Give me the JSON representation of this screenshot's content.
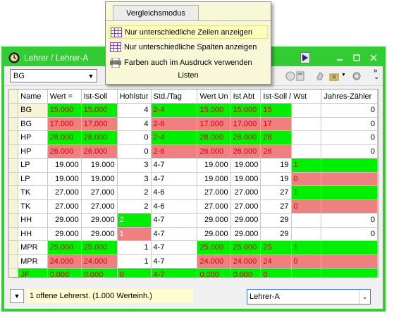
{
  "window": {
    "title": "Lehrer / Lehrer-A",
    "accent": "#33cc33"
  },
  "toolbar": {
    "combo_value": "BG"
  },
  "menu": {
    "tab": "Vergleichsmodus",
    "items": [
      "Nur unterschiedliche Zeilen anzeigen",
      "Nur unterschiedliche Spalten anzeigen",
      "Farben auch im Ausdruck verwenden"
    ],
    "footer": "Listen"
  },
  "grid": {
    "headers": [
      "Name",
      "Wert =",
      "Ist-Soll",
      "Hohlstur",
      "Std./Tag",
      "Wert Un",
      "Ist Abt",
      "Ist-Soll / Wst",
      "",
      "Jahres-Zähler"
    ],
    "rows": [
      {
        "name": "BG",
        "wert": "15.000",
        "ist": "15.000",
        "hohl": "4",
        "std": "2-4",
        "wun": "15.000",
        "abt": "15.000",
        "iw": "15",
        "wst": "",
        "jz": "0",
        "style": "sel-green"
      },
      {
        "name": "BG",
        "wert": "17.000",
        "ist": "17.000",
        "hohl": "4",
        "std": "2-6",
        "wun": "17.000",
        "abt": "17.000",
        "iw": "17",
        "wst": "",
        "jz": "0",
        "style": "red"
      },
      {
        "name": "HP",
        "wert": "28.000",
        "ist": "28.000",
        "hohl": "0",
        "std": "2-4",
        "wun": "28.000",
        "abt": "28.000",
        "iw": "28",
        "wst": "",
        "jz": "0",
        "style": "green"
      },
      {
        "name": "HP",
        "wert": "26.000",
        "ist": "26.000",
        "hohl": "0",
        "std": "2-6",
        "wun": "26.000",
        "abt": "26.000",
        "iw": "26",
        "wst": "",
        "jz": "0",
        "style": "red"
      },
      {
        "name": "LP",
        "wert": "19.000",
        "ist": "19.000",
        "hohl": "3",
        "std": "4-7",
        "wun": "19.000",
        "abt": "19.000",
        "iw": "19",
        "wst": "1",
        "jz": "",
        "style": "plain-g"
      },
      {
        "name": "LP",
        "wert": "19.000",
        "ist": "19.000",
        "hohl": "3",
        "std": "4-7",
        "wun": "19.000",
        "abt": "19.000",
        "iw": "19",
        "wst": "0",
        "jz": "",
        "style": "plain-r"
      },
      {
        "name": "TK",
        "wert": "27.000",
        "ist": "27.000",
        "hohl": "2",
        "std": "4-6",
        "wun": "27.000",
        "abt": "27.000",
        "iw": "27",
        "wst": "1",
        "jz": "",
        "style": "plain-g"
      },
      {
        "name": "TK",
        "wert": "27.000",
        "ist": "27.000",
        "hohl": "2",
        "std": "4-6",
        "wun": "27.000",
        "abt": "27.000",
        "iw": "27",
        "wst": "0",
        "jz": "",
        "style": "plain-r"
      },
      {
        "name": "HH",
        "wert": "29.000",
        "ist": "29.000",
        "hohl": "2",
        "std": "4-7",
        "wun": "29.000",
        "abt": "29.000",
        "iw": "29",
        "wst": "",
        "jz": "0",
        "style": "hohl-g"
      },
      {
        "name": "HH",
        "wert": "29.000",
        "ist": "29.000",
        "hohl": "1",
        "std": "4-7",
        "wun": "29.000",
        "abt": "29.000",
        "iw": "29",
        "wst": "",
        "jz": "0",
        "style": "hohl-r"
      },
      {
        "name": "MPR",
        "wert": "25.000",
        "ist": "25.000",
        "hohl": "1",
        "std": "4-7",
        "wun": "25.000",
        "abt": "25.000",
        "iw": "25",
        "wst": "1",
        "jz": "",
        "style": "mpr-g"
      },
      {
        "name": "MPR",
        "wert": "24.000",
        "ist": "24.000",
        "hohl": "1",
        "std": "4-7",
        "wun": "24.000",
        "abt": "24.000",
        "iw": "24",
        "wst": "0",
        "jz": "",
        "style": "mpr-r"
      },
      {
        "name": "JF",
        "wert": "0.000",
        "ist": "0.000",
        "hohl": "0",
        "std": "4-7",
        "wun": "0.000",
        "abt": "0.000",
        "iw": "0",
        "wst": "",
        "jz": "",
        "style": "allgreen"
      }
    ]
  },
  "status": {
    "text": "1 offene Lehrerst. (1.000 Werteinh.)",
    "combo_value": "Lehrer-A"
  }
}
